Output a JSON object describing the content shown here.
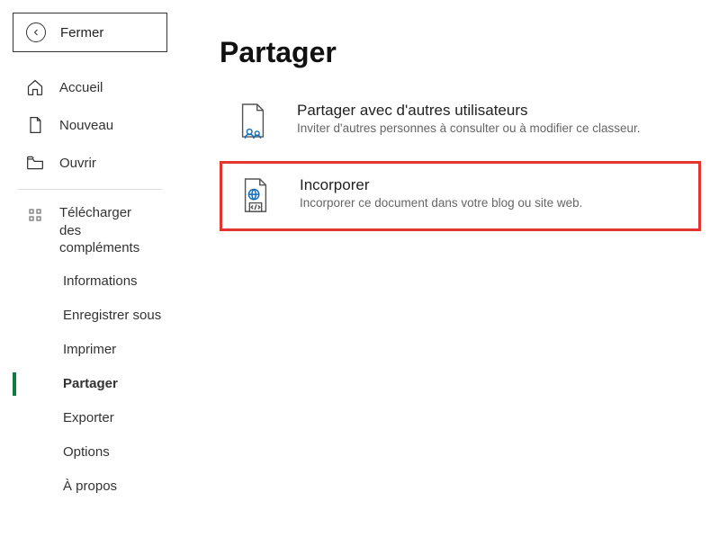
{
  "sidebar": {
    "close_label": "Fermer",
    "nav": {
      "home": "Accueil",
      "new": "Nouveau",
      "open": "Ouvrir"
    },
    "addins_label": "Télécharger des compléments",
    "sub_items": {
      "info": "Informations",
      "save_as": "Enregistrer sous",
      "print": "Imprimer",
      "share": "Partager",
      "export": "Exporter",
      "options": "Options",
      "about": "À propos"
    }
  },
  "main": {
    "title": "Partager",
    "share_users": {
      "title": "Partager avec d'autres utilisateurs",
      "desc": "Inviter d'autres personnes à consulter ou à modifier ce classeur."
    },
    "embed": {
      "title": "Incorporer",
      "desc": "Incorporer ce document dans votre blog ou site web."
    }
  }
}
